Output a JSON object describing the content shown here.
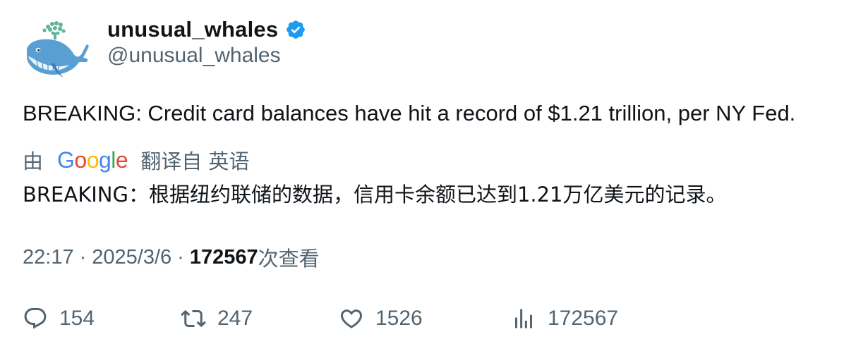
{
  "author": {
    "display_name": "unusual_whales",
    "handle": "@unusual_whales",
    "avatar_icon": "whale-avatar-icon",
    "verified_icon": "verified-badge-icon",
    "verified_color": "#1d9bf0"
  },
  "tweet": {
    "text": "BREAKING: Credit card balances have hit a record of $1.21 trillion, per NY Fed."
  },
  "translation": {
    "prefix": "由",
    "provider": "Google",
    "suffix": "翻译自 英语",
    "text": "BREAKING：根据纽约联储的数据，信用卡余额已达到1.21万亿美元的记录。"
  },
  "meta": {
    "time": "22:17",
    "separator": "·",
    "date": "2025/3/6",
    "views_count": "172567",
    "views_label": "次查看"
  },
  "actions": {
    "reply_count": "154",
    "retweet_count": "247",
    "like_count": "1526",
    "views_count": "172567"
  },
  "colors": {
    "text_primary": "#0f1419",
    "text_secondary": "#536471",
    "google_blue": "#4285F4",
    "google_red": "#EA4335",
    "google_yellow": "#FBBC05",
    "google_green": "#34A853"
  }
}
